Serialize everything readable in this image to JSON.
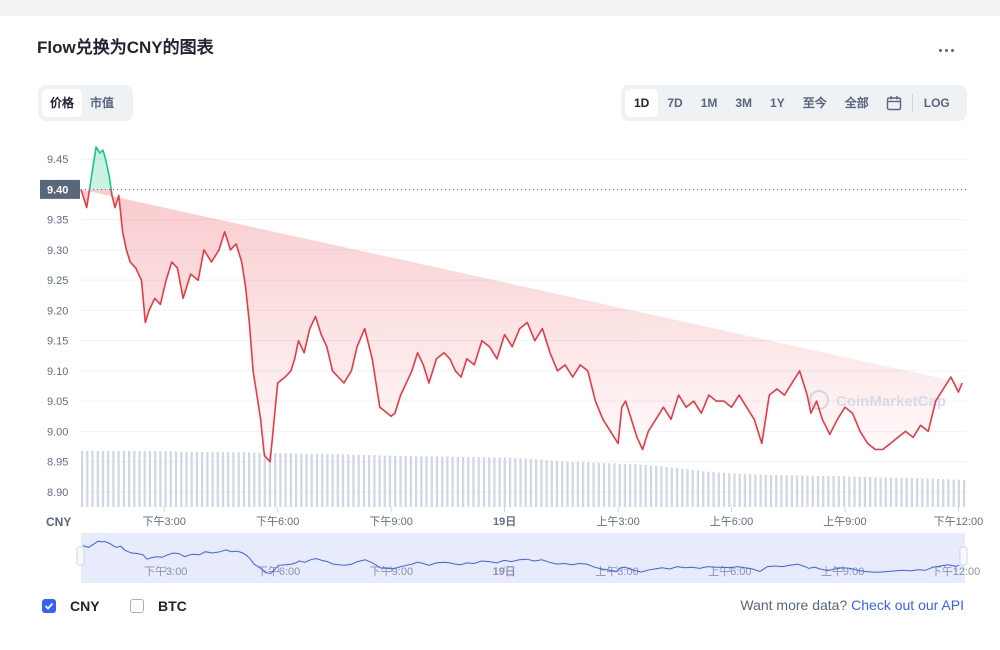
{
  "title": "Flow兑换为CNY的图表",
  "menu_icon": "more-horizontal-icon",
  "metric_tabs": [
    "价格",
    "市值"
  ],
  "active_metric": "价格",
  "range_tabs": [
    "1D",
    "7D",
    "1M",
    "3M",
    "1Y",
    "至今",
    "全部"
  ],
  "active_range": "1D",
  "calendar_icon": "calendar-icon",
  "log_label": "LOG",
  "currency_axis_label": "CNY",
  "current_price_label": "9.40",
  "watermark": "CoinMarketCap",
  "colors": {
    "up": "#16c784",
    "down": "#ea3943",
    "navigator_line": "#3861fb",
    "volume": "#cfd6e4",
    "accent": "#3861fb"
  },
  "chart_data": {
    "type": "line",
    "title": "Flow兑换为CNY的图表",
    "ylabel": "",
    "xlabel": "",
    "yticks": [
      8.9,
      8.95,
      9.0,
      9.05,
      9.1,
      9.15,
      9.2,
      9.25,
      9.3,
      9.35,
      9.4,
      9.45
    ],
    "ylim": [
      8.875,
      9.49
    ],
    "reference_value": 9.4,
    "xticks": [
      "下午3:00",
      "下午6:00",
      "下午9:00",
      "19日",
      "上午3:00",
      "上午6:00",
      "上午9:00",
      "下午12:00"
    ],
    "xtick_hours": [
      2,
      5,
      8,
      11,
      14,
      17,
      20,
      23
    ],
    "x_hours_range": [
      -0.2,
      23.2
    ],
    "grid": true,
    "series": [
      {
        "name": "CNY",
        "x_hours": [
          -0.2,
          -0.05,
          0.1,
          0.2,
          0.3,
          0.38,
          0.45,
          0.55,
          0.62,
          0.7,
          0.8,
          0.9,
          1.0,
          1.1,
          1.25,
          1.4,
          1.5,
          1.6,
          1.75,
          1.9,
          2.05,
          2.2,
          2.35,
          2.5,
          2.7,
          2.9,
          3.05,
          3.25,
          3.45,
          3.6,
          3.75,
          3.9,
          4.05,
          4.15,
          4.25,
          4.35,
          4.45,
          4.55,
          4.65,
          4.8,
          5.0,
          5.2,
          5.35,
          5.45,
          5.55,
          5.7,
          5.85,
          6.0,
          6.15,
          6.3,
          6.45,
          6.6,
          6.75,
          6.85,
          6.95,
          7.1,
          7.3,
          7.5,
          7.7,
          7.9,
          8.0,
          8.1,
          8.25,
          8.4,
          8.55,
          8.7,
          8.85,
          9.0,
          9.2,
          9.4,
          9.55,
          9.7,
          9.85,
          10.0,
          10.2,
          10.4,
          10.6,
          10.8,
          11.0,
          11.2,
          11.4,
          11.6,
          11.8,
          12.0,
          12.2,
          12.4,
          12.6,
          12.8,
          13.0,
          13.2,
          13.4,
          13.6,
          13.8,
          14.0,
          14.1,
          14.2,
          14.35,
          14.5,
          14.65,
          14.8,
          15.0,
          15.2,
          15.4,
          15.6,
          15.8,
          16.0,
          16.2,
          16.4,
          16.6,
          16.8,
          17.0,
          17.2,
          17.4,
          17.6,
          17.8,
          18.0,
          18.2,
          18.4,
          18.6,
          18.8,
          19.0,
          19.1,
          19.25,
          19.4,
          19.6,
          19.8,
          20.0,
          20.2,
          20.4,
          20.6,
          20.8,
          21.0,
          21.2,
          21.4,
          21.6,
          21.8,
          22.0,
          22.2,
          22.4,
          22.6,
          22.8,
          23.0,
          23.1,
          23.2
        ],
        "values": [
          9.4,
          9.37,
          9.43,
          9.47,
          9.46,
          9.465,
          9.45,
          9.42,
          9.39,
          9.37,
          9.39,
          9.33,
          9.3,
          9.28,
          9.27,
          9.25,
          9.18,
          9.2,
          9.22,
          9.21,
          9.25,
          9.28,
          9.27,
          9.22,
          9.26,
          9.25,
          9.3,
          9.28,
          9.3,
          9.33,
          9.3,
          9.31,
          9.28,
          9.24,
          9.18,
          9.1,
          9.06,
          9.02,
          8.96,
          8.95,
          9.08,
          9.09,
          9.1,
          9.12,
          9.15,
          9.13,
          9.17,
          9.19,
          9.16,
          9.14,
          9.1,
          9.09,
          9.08,
          9.09,
          9.1,
          9.14,
          9.17,
          9.12,
          9.04,
          9.03,
          9.025,
          9.03,
          9.06,
          9.08,
          9.1,
          9.13,
          9.11,
          9.08,
          9.12,
          9.13,
          9.12,
          9.1,
          9.09,
          9.12,
          9.11,
          9.15,
          9.14,
          9.12,
          9.16,
          9.14,
          9.17,
          9.18,
          9.15,
          9.17,
          9.13,
          9.1,
          9.11,
          9.09,
          9.11,
          9.1,
          9.05,
          9.02,
          9.0,
          8.98,
          9.04,
          9.05,
          9.02,
          8.99,
          8.97,
          9.0,
          9.02,
          9.04,
          9.02,
          9.06,
          9.04,
          9.05,
          9.03,
          9.06,
          9.05,
          9.05,
          9.04,
          9.06,
          9.04,
          9.02,
          8.98,
          9.06,
          9.07,
          9.06,
          9.08,
          9.1,
          9.06,
          9.03,
          9.05,
          9.02,
          8.995,
          9.02,
          9.04,
          9.03,
          9.0,
          8.98,
          8.97,
          8.97,
          8.98,
          8.99,
          9.0,
          8.99,
          9.01,
          9.0,
          9.05,
          9.07,
          9.09,
          9.065,
          9.08
        ]
      }
    ],
    "volume_relative": [
      1.0,
      1.0,
      1.0,
      1.0,
      0.995,
      0.99,
      0.98,
      0.97,
      0.965,
      0.96,
      0.955,
      0.94,
      0.93,
      0.92,
      0.91,
      0.9,
      0.885,
      0.87,
      0.86,
      0.85,
      0.84,
      0.83,
      0.82,
      0.81,
      0.8,
      0.79,
      0.76,
      0.72,
      0.68,
      0.66,
      0.64,
      0.62,
      0.6,
      0.56,
      0.5,
      0.45,
      0.38,
      0.34,
      0.31,
      0.29,
      0.27,
      0.26,
      0.25,
      0.24,
      0.23,
      0.22,
      0.2,
      0.19,
      0.18,
      0.17,
      0.14,
      0.12
    ]
  },
  "navigator": {
    "xticks": [
      "下午3:00",
      "下午6:00",
      "下午9:00",
      "19日",
      "上午3:00",
      "上午6:00",
      "上午9:00",
      "下午12:00"
    ]
  },
  "footer": {
    "series_toggles": [
      {
        "label": "CNY",
        "checked": true
      },
      {
        "label": "BTC",
        "checked": false
      }
    ],
    "more_data_text": "Want more data?",
    "more_data_link": "Check out our API"
  }
}
